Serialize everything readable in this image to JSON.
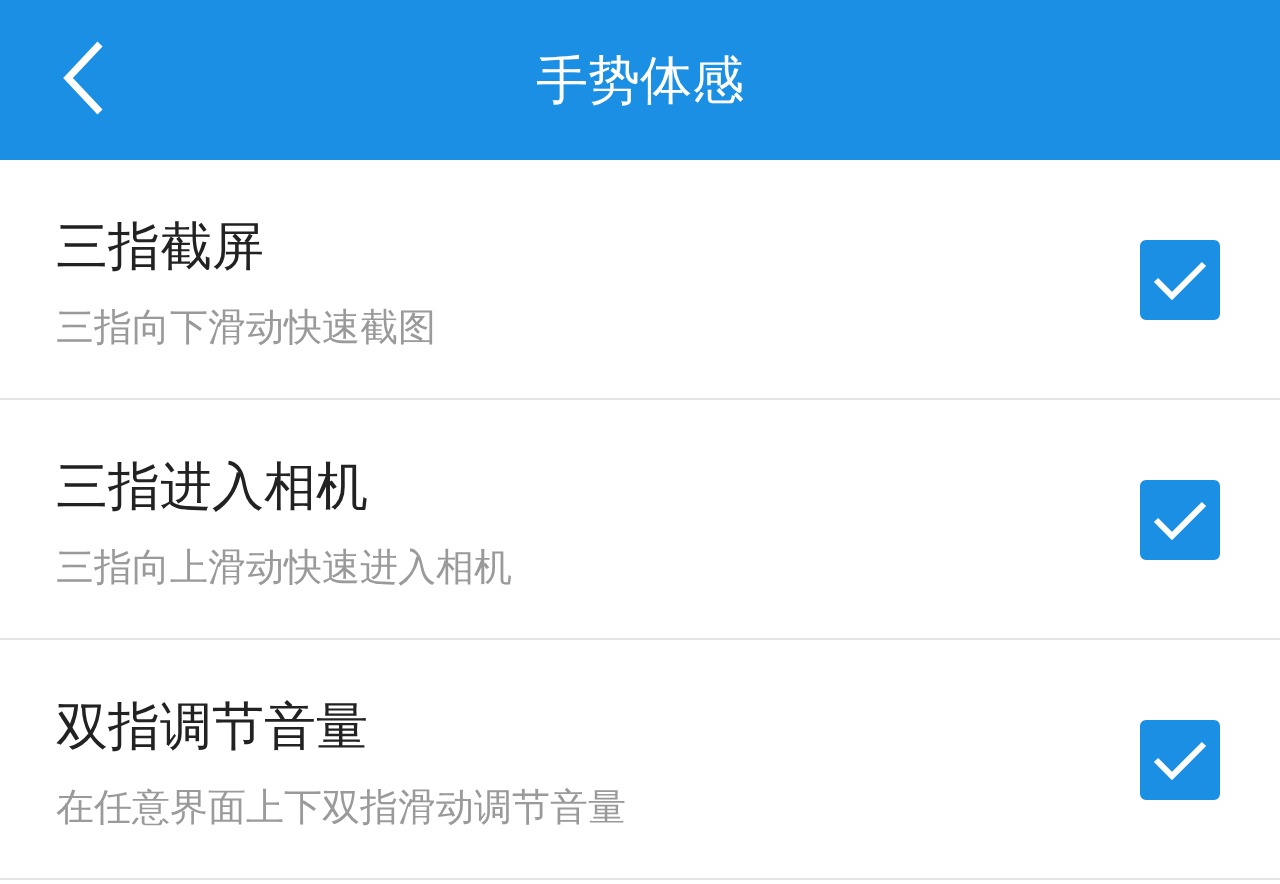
{
  "header": {
    "title": "手势体感"
  },
  "items": [
    {
      "title": "三指截屏",
      "subtitle": "三指向下滑动快速截图",
      "checked": true
    },
    {
      "title": "三指进入相机",
      "subtitle": "三指向上滑动快速进入相机",
      "checked": true
    },
    {
      "title": "双指调节音量",
      "subtitle": "在任意界面上下双指滑动调节音量",
      "checked": true
    }
  ]
}
